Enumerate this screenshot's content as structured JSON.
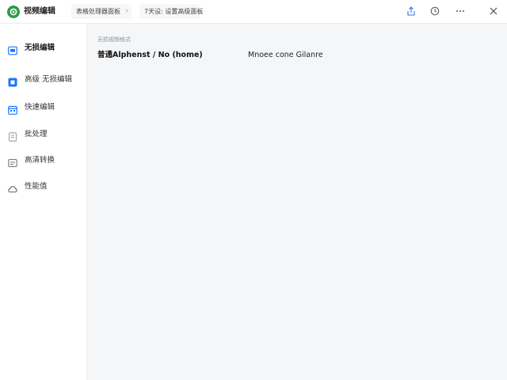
{
  "app": {
    "name": "视频编辑"
  },
  "tabs": [
    {
      "label": "表格处理器面板"
    },
    {
      "label": "7天设: 设置高级面板"
    }
  ],
  "nav": {
    "items": [
      {
        "label": "无损编辑",
        "icon": "monitor-icon",
        "active": true
      },
      {
        "label": "高级 无损编辑",
        "icon": "square-icon",
        "active": false
      },
      {
        "label": "快速编辑",
        "icon": "calendar-icon",
        "active": false
      },
      {
        "label": "批处理",
        "icon": "document-icon",
        "active": false
      },
      {
        "label": "高清转换",
        "icon": "image-icon",
        "active": false
      },
      {
        "label": "性能值",
        "icon": "cloud-icon",
        "active": false
      }
    ]
  },
  "main": {
    "section_caption": "无损视频格式",
    "row": {
      "label": "普通Alphenst  /  No (home)",
      "value": "Mnoee cone Gilanre"
    }
  },
  "colors": {
    "accent": "#1677ff",
    "logo": "#2f9a47",
    "sidebar_bg": "#ffffff",
    "content_bg": "#f5f6f8"
  }
}
